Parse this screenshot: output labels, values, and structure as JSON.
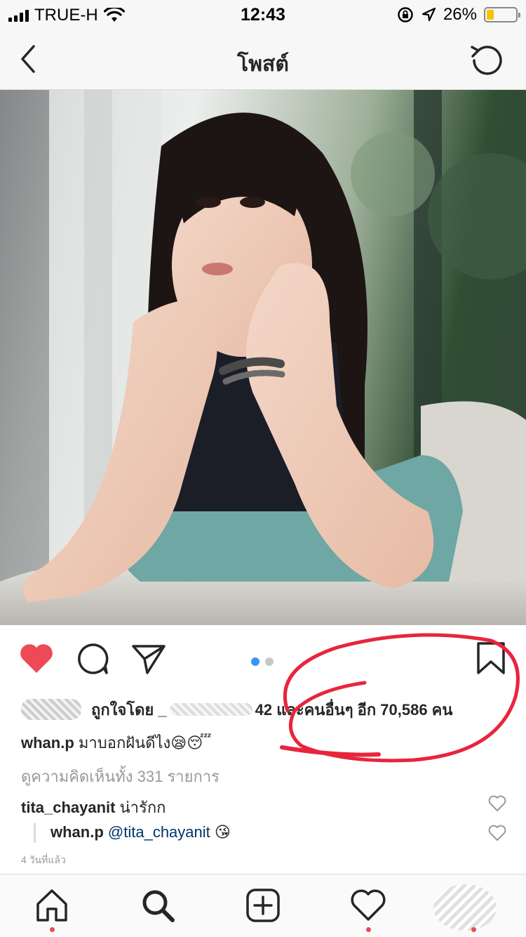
{
  "status_bar": {
    "carrier": "TRUE-H",
    "time": "12:43",
    "battery_percent": "26%",
    "battery_level": 0.26,
    "battery_color": "#f5c400"
  },
  "nav": {
    "title": "โพสต์",
    "back_icon": "chevron-left-icon",
    "refresh_icon": "refresh-icon"
  },
  "photo": {
    "alt_subject": "post-photo"
  },
  "actions": {
    "like_icon": "heart-filled-icon",
    "comment_icon": "comment-icon",
    "share_icon": "direct-share-icon",
    "save_icon": "bookmark-icon",
    "carousel_dots": 2,
    "carousel_active": 1,
    "like_color": "#ed4956",
    "dot_active_color": "#3897f0"
  },
  "likes": {
    "prefix": "ถูกใจโดย _",
    "suffix": "42 และคนอื่นๆ อีก 70,586 คน"
  },
  "caption": {
    "username": "whan.p",
    "text": "มาบอกฝันดีไง",
    "emoji": "😪😴"
  },
  "view_comments": "ดูความคิดเห็นทั้ง 331 รายการ",
  "comments": [
    {
      "username": "tita_chayanit",
      "text": "น่ารักก"
    },
    {
      "username": "whan.p",
      "mention": "@tita_chayanit",
      "emoji": "😘"
    }
  ],
  "timestamp": "4 วันที่แล้ว",
  "annotation_color": "#e8253d",
  "tab_bar": {
    "items": [
      "home-icon",
      "search-icon",
      "new-post-icon",
      "activity-icon",
      "profile-avatar"
    ]
  }
}
